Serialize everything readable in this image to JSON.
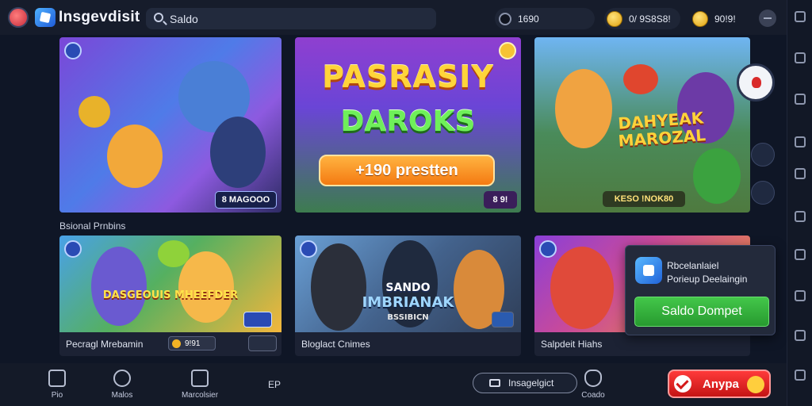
{
  "header": {
    "brand": "Insgevdisit",
    "search": {
      "placeholder": "Saldo"
    },
    "user_value": "1690",
    "coins_value": "0/ 9S8S8!",
    "gems_value": "90!9!"
  },
  "featured": [
    {
      "tag": "8 MAGOOO"
    },
    {
      "title_line1": "PASRASIY",
      "title_line2": "DAROKS",
      "promo": "+190 prestten",
      "tag": "8 9!"
    },
    {
      "title": "DAHYEAK MAROZAL",
      "tag": "KESO !NOK80"
    }
  ],
  "section_label": "Bsional Prnbins",
  "games": [
    {
      "title": "Pecragl Mrebamin",
      "art_title": "DASGEOUIS MHEEFDER",
      "price": "9!91"
    },
    {
      "title": "Bloglact Cnimes",
      "art_title_line1": "SANDO",
      "art_title_line2": "IMBRIANAK",
      "art_sub": "BSSIBICN"
    },
    {
      "title": "Salpdeit Hiahs"
    }
  ],
  "popup": {
    "title": "Rbcelanlaiel",
    "subtitle": "Porieup Deelaingin",
    "button": "Saldo Dompet"
  },
  "bottom_nav": [
    {
      "label": "Pio",
      "icon": "home-icon"
    },
    {
      "label": "Malos",
      "icon": "clock-icon"
    },
    {
      "label": "Marcolsier",
      "icon": "dice-icon"
    },
    {
      "label": "Coado",
      "icon": "shield-icon"
    }
  ],
  "bottom_ep": "EP",
  "outline_button": "Insagelgict",
  "play_button": "Anypa",
  "colors": {
    "accent_green": "#2fae36",
    "accent_red": "#e02424",
    "gold": "#f6c333",
    "bg": "#0f1626"
  }
}
